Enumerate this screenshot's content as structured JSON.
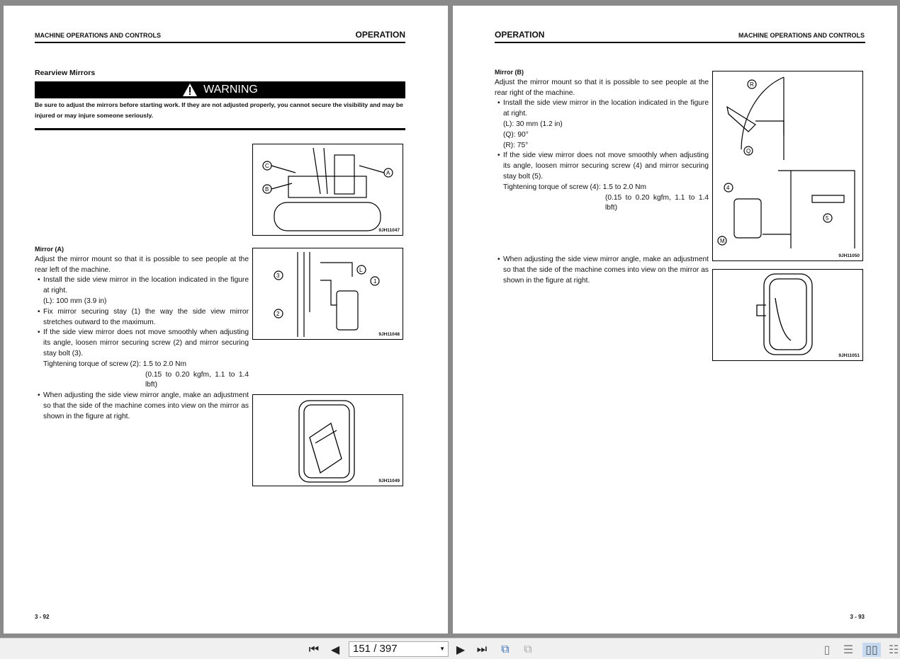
{
  "left_page": {
    "header_left": "MACHINE OPERATIONS AND CONTROLS",
    "header_right": "OPERATION",
    "section_title": "Rearview Mirrors",
    "warning_label": "WARNING",
    "warning_text": "Be sure to adjust the mirrors before starting work. If they are not adjusted properly, you cannot secure the visibility and may be injured or may injure someone seriously.",
    "mirror_a_title": "Mirror (A)",
    "mirror_a_intro": "Adjust the mirror mount so that it is possible to see people at the rear left of the machine.",
    "bullet1": "Install the side view mirror in the location indicated in the figure at right.",
    "bullet1_l": "(L): 100 mm (3.9 in)",
    "bullet2": "Fix mirror securing stay (1) the way the side view mirror stretches outward to the maximum.",
    "bullet3": "If the side view mirror does not move smoothly when adjusting its angle, loosen mirror securing screw (2) and mirror securing stay bolt (3).",
    "torque_label": "Tightening torque of screw (2):",
    "torque_value": "1.5 to 2.0 Nm",
    "torque_alt": "(0.15 to 0.20 kgfm, 1.1 to 1.4 lbft)",
    "bullet4": "When adjusting the side view mirror angle, make an adjustment so that the side of the machine comes into view on the mirror as shown in the figure at right.",
    "fig1_caption": "9JH11047",
    "fig2_caption": "9JH11048",
    "fig3_caption": "9JH11049",
    "fig1_labels": [
      "C",
      "B",
      "A"
    ],
    "fig2_labels": [
      "3",
      "2",
      "1",
      "L"
    ],
    "page_number": "3 - 92"
  },
  "right_page": {
    "header_left": "OPERATION",
    "header_right": "MACHINE OPERATIONS AND CONTROLS",
    "mirror_b_title": "Mirror (B)",
    "mirror_b_intro": "Adjust the mirror mount so that it is possible to see people at the rear right of the machine.",
    "bullet1": "Install the side view mirror in the location indicated in the figure at right.",
    "l_value": "(L): 30 mm (1.2 in)",
    "q_value": "(Q): 90°",
    "r_value": "(R): 75°",
    "bullet2": "If the side view mirror does not move smoothly when adjusting its angle, loosen mirror securing screw (4) and mirror securing stay bolt (5).",
    "torque_label": "Tightening torque of screw (4):",
    "torque_value": "1.5 to 2.0 Nm",
    "torque_alt": "(0.15 to 0.20 kgfm, 1.1 to 1.4 lbft)",
    "bullet3": "When adjusting the side view mirror angle, make an adjustment so that the side of the machine comes into view on the mirror as shown in the figure at right.",
    "fig4_caption": "9JH11050",
    "fig5_caption": "9JH11051",
    "fig4_labels": [
      "R",
      "Q",
      "4",
      "5",
      "M"
    ],
    "page_number": "3 - 93"
  },
  "toolbar": {
    "page_indicator": "151 / 397",
    "current_page": 151,
    "total_pages": 397,
    "view_mode_active": "two-page"
  }
}
